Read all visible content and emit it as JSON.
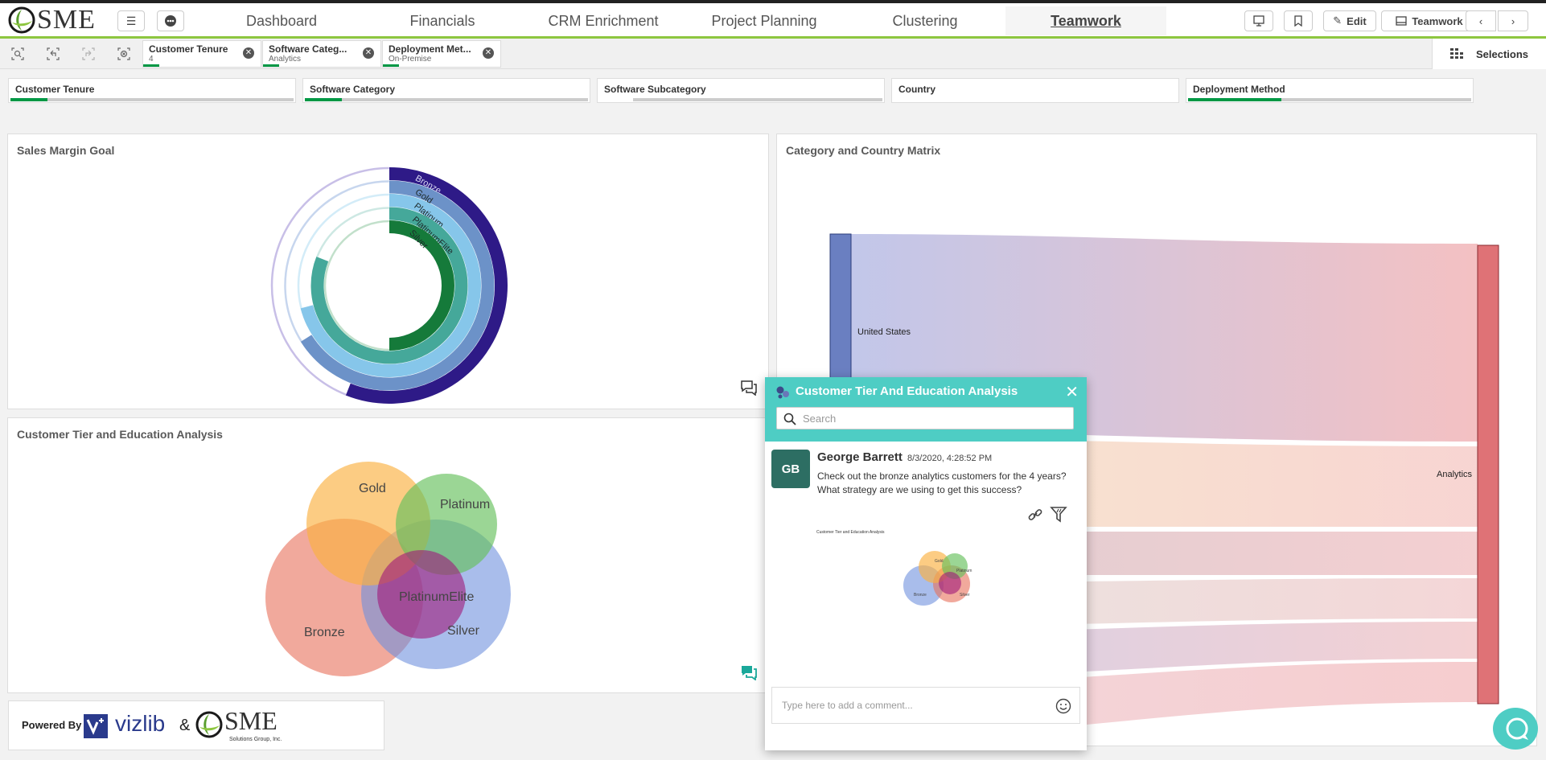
{
  "app": {
    "logo_text": "SME"
  },
  "nav": {
    "tabs": [
      {
        "label": "Dashboard"
      },
      {
        "label": "Financials"
      },
      {
        "label": "CRM Enrichment"
      },
      {
        "label": "Project Planning"
      },
      {
        "label": "Clustering"
      },
      {
        "label": "Teamwork"
      }
    ],
    "active_tab": "Teamwork",
    "edit_label": "Edit",
    "sheet_label": "Teamwork"
  },
  "selection_bar": {
    "chips": [
      {
        "title": "Customer Tenure",
        "value": "4"
      },
      {
        "title": "Software Categ...",
        "value": "Analytics"
      },
      {
        "title": "Deployment Met...",
        "value": "On-Premise"
      }
    ],
    "selections_label": "Selections"
  },
  "filters": [
    {
      "label": "Customer Tenure",
      "fill": 0.13
    },
    {
      "label": "Software Category",
      "fill": 0.13
    },
    {
      "label": "Software Subcategory",
      "fill": 0
    },
    {
      "label": "Country",
      "fill": 0
    },
    {
      "label": "Deployment Method",
      "fill": 0.33
    }
  ],
  "panels": {
    "sales_margin": {
      "title": "Sales Margin Goal",
      "rings": [
        {
          "label": "Bronze",
          "color": "#2e1a87",
          "goal_color": "#c8bfe7",
          "pct": 0.56
        },
        {
          "label": "Gold",
          "color": "#6c92c8",
          "goal_color": "#c7d6ee",
          "pct": 0.66
        },
        {
          "label": "Platinum",
          "color": "#86c6ea",
          "goal_color": "#d3ecf8",
          "pct": 0.71
        },
        {
          "label": "PlatinumElite",
          "color": "#45a89a",
          "goal_color": "#cde8e3",
          "pct": 0.81
        },
        {
          "label": "Silver",
          "color": "#157a3a",
          "goal_color": "#c2e0cb",
          "pct": 0.5
        }
      ]
    },
    "matrix": {
      "title": "Category and Country Matrix",
      "source_label": "United States",
      "target_label": "Analytics"
    },
    "tier": {
      "title": "Customer Tier and Education Analysis",
      "sets": [
        {
          "label": "Gold",
          "color": "#fbb040"
        },
        {
          "label": "Platinum",
          "color": "#66c05c"
        },
        {
          "label": "Bronze",
          "color": "#e8705a"
        },
        {
          "label": "Silver",
          "color": "#6f91de"
        },
        {
          "label": "PlatinumElite",
          "color": "#a0197a"
        }
      ]
    }
  },
  "powered_by": {
    "label": "Powered By",
    "brand1": "vizlib",
    "amp": "&",
    "brand2": "SME",
    "brand2_sub": "Solutions Group, Inc."
  },
  "comment_popup": {
    "title": "Customer Tier And Education Analysis",
    "search_placeholder": "Search",
    "author_initials": "GB",
    "author": "George Barrett",
    "time": "8/3/2020, 4:28:52 PM",
    "text": "Check out the bronze analytics customers for the 4 years? What strategy are we using to get this success?",
    "thumbnail_title": "Customer Tier and Education Analysis",
    "thumb_labels": [
      "Gold",
      "Platinum",
      "Bronze",
      "Silver"
    ],
    "input_placeholder": "Type here to add a comment..."
  }
}
